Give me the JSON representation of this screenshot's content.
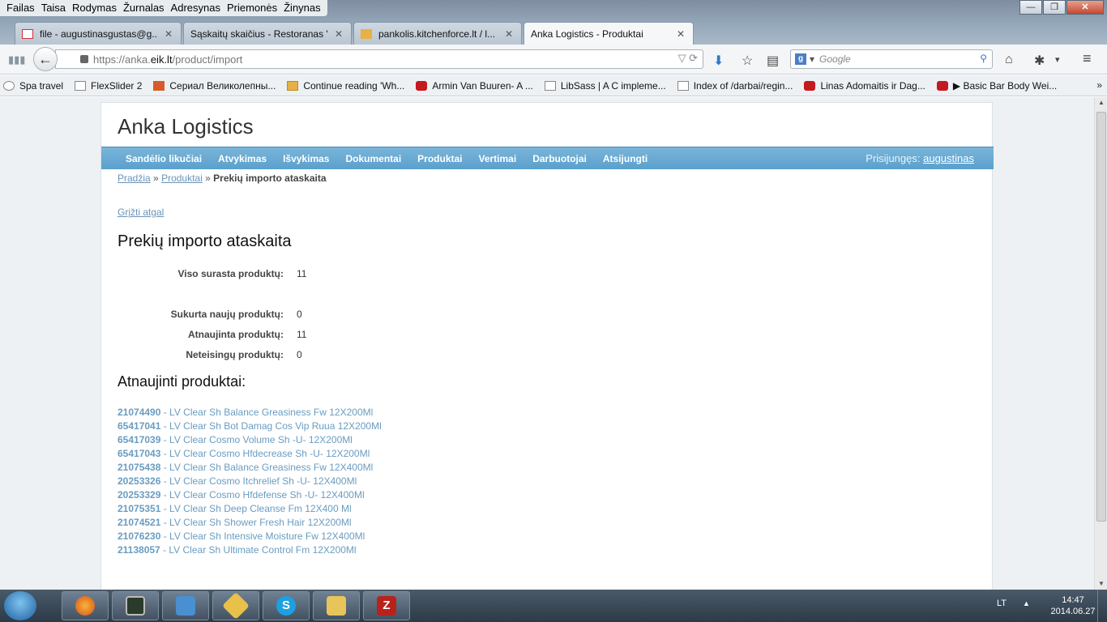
{
  "menubar": {
    "items": [
      "Failas",
      "Taisa",
      "Rodymas",
      "Žurnalas",
      "Adresynas",
      "Priemonės",
      "Žinynas"
    ]
  },
  "window_controls": {
    "minimize": "—",
    "maximize": "❐",
    "close": "✕"
  },
  "tabs": [
    {
      "label": "file - augustinasgustas@g...",
      "icon": "gmail-icon",
      "active": false
    },
    {
      "label": "Sąskaitų skaičius - Restoranas \"...",
      "icon": "page-icon",
      "active": false
    },
    {
      "label": "pankolis.kitchenforce.lt / l...",
      "icon": "phpmyadmin-icon",
      "active": false
    },
    {
      "label": "Anka Logistics - Produktai",
      "icon": "",
      "active": true
    }
  ],
  "new_tab": "+",
  "address_bar": {
    "prefix": "https://anka.",
    "domain": "eik.lt",
    "path": "/product/import"
  },
  "search": {
    "engine": "Google",
    "placeholder": "Google"
  },
  "bookmarks": [
    {
      "label": "Spa travel",
      "icon": "smile"
    },
    {
      "label": "FlexSlider 2",
      "icon": "page"
    },
    {
      "label": "Сериал Великолепны...",
      "icon": "ru"
    },
    {
      "label": "Continue reading 'Wh...",
      "icon": "pma"
    },
    {
      "label": "Armin Van Buuren- A ...",
      "icon": "yt"
    },
    {
      "label": "LibSass | A C impleme...",
      "icon": "page"
    },
    {
      "label": "Index of /darbai/regin...",
      "icon": "page"
    },
    {
      "label": "Linas Adomaitis ir Dag...",
      "icon": "yt"
    },
    {
      "label": "▶ Basic Bar Body Wei...",
      "icon": "yt"
    }
  ],
  "site": {
    "title": "Anka Logistics",
    "menu": [
      "Sandėlio likučiai",
      "Atvykimas",
      "Išvykimas",
      "Dokumentai",
      "Produktai",
      "Vertimai",
      "Darbuotojai",
      "Atsijungti"
    ],
    "login_label": "Prisijungęs:",
    "login_user": "augustinas"
  },
  "breadcrumb": {
    "home": "Pradžia",
    "sep1": "»",
    "section": "Produktai",
    "sep2": "»",
    "current": "Prekių importo ataskaita"
  },
  "back_link": "Grįžti atgal",
  "report": {
    "title": "Prekių importo ataskaita",
    "stats": [
      {
        "label": "Viso surasta produktų:",
        "value": "11"
      },
      {
        "label": "Sukurta naujų produktų:",
        "value": "0"
      },
      {
        "label": "Atnaujinta produktų:",
        "value": "11"
      },
      {
        "label": "Neteisingų produktų:",
        "value": "0"
      }
    ],
    "updated_title": "Atnaujinti produktai:",
    "products": [
      {
        "code": "21074490",
        "name": " - LV Clear Sh Balance Greasiness Fw 12X200Ml"
      },
      {
        "code": "65417041",
        "name": " - LV Clear Sh Bot Damag Cos Vip Ruua 12X200Ml"
      },
      {
        "code": "65417039",
        "name": " - LV Clear Cosmo Volume Sh -U- 12X200Ml"
      },
      {
        "code": "65417043",
        "name": " - LV Clear Cosmo Hfdecrease Sh -U- 12X200Ml"
      },
      {
        "code": "21075438",
        "name": " - LV Clear Sh Balance Greasiness Fw 12X400Ml"
      },
      {
        "code": "20253326",
        "name": " - LV Clear Cosmo Itchrelief Sh -U- 12X400Ml"
      },
      {
        "code": "20253329",
        "name": " - LV Clear Cosmo Hfdefense Sh -U- 12X400Ml"
      },
      {
        "code": "21075351",
        "name": " - LV Clear Sh Deep Cleanse Fm 12X400 Ml"
      },
      {
        "code": "21074521",
        "name": " - LV Clear Sh Shower Fresh Hair 12X200Ml"
      },
      {
        "code": "21076230",
        "name": " - LV Clear Sh Intensive Moisture Fw 12X400Ml"
      },
      {
        "code": "21138057",
        "name": " - LV Clear Sh Ultimate Control Fm 12X200Ml"
      }
    ]
  },
  "taskbar": {
    "apps": [
      "firefox-icon",
      "terminal-icon",
      "notebook-icon",
      "winamp-icon",
      "skype-icon",
      "folder-icon",
      "filezilla-icon"
    ],
    "lang": "LT",
    "time": "14:47",
    "date": "2014.06.27"
  },
  "colors": {
    "menu_blue": "#5aa0cd",
    "link": "#6a93b6",
    "product_link": "#6a9cc0"
  }
}
